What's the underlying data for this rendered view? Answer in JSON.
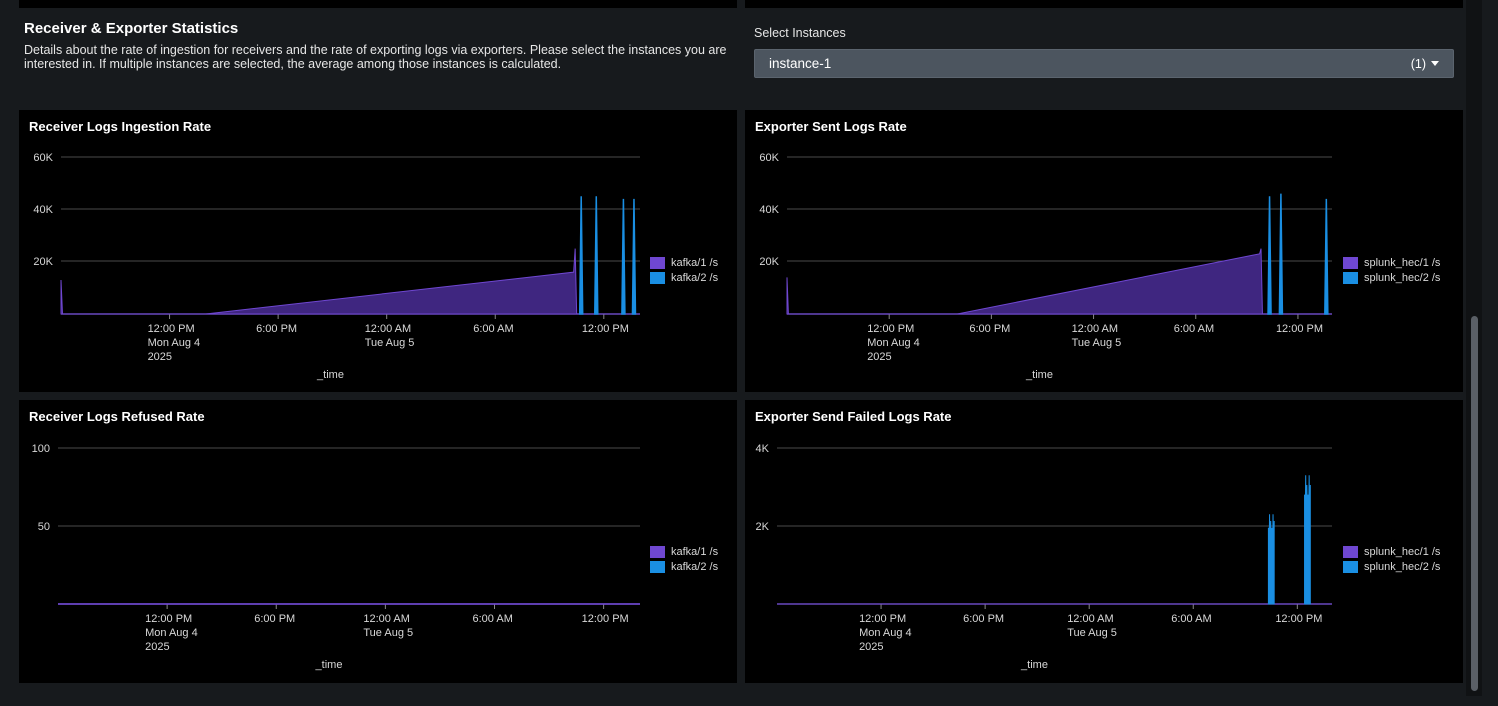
{
  "header": {
    "title": "Receiver & Exporter Statistics",
    "description": "Details about the rate of ingestion for receivers and the rate of exporting logs via exporters. Please select the instances you are interested in. If multiple instances are selected, the average among those instances is calculated."
  },
  "instance_select": {
    "label": "Select Instances",
    "value": "instance-1",
    "count": "(1)"
  },
  "colors": {
    "series1": "#6f47d1",
    "series1_fill": "#3f2680",
    "series2": "#1a8fe3"
  },
  "panels": [
    {
      "title": "Receiver Logs Ingestion Rate",
      "x_title": "_time",
      "y_ticks": [
        "60K",
        "40K",
        "20K"
      ],
      "legend": [
        "kafka/1 /s",
        "kafka/2 /s"
      ]
    },
    {
      "title": "Exporter Sent Logs Rate",
      "x_title": "_time",
      "y_ticks": [
        "60K",
        "40K",
        "20K"
      ],
      "legend": [
        "splunk_hec/1 /s",
        "splunk_hec/2 /s"
      ]
    },
    {
      "title": "Receiver Logs Refused Rate",
      "x_title": "_time",
      "y_ticks": [
        "100",
        "50"
      ],
      "legend": [
        "kafka/1 /s",
        "kafka/2 /s"
      ]
    },
    {
      "title": "Exporter Send Failed Logs Rate",
      "x_title": "_time",
      "y_ticks": [
        "4K",
        "2K"
      ],
      "legend": [
        "splunk_hec/1 /s",
        "splunk_hec/2 /s"
      ]
    }
  ],
  "x_ticks": [
    {
      "lines": [
        "12:00 PM",
        "Mon Aug 4",
        "2025"
      ]
    },
    {
      "lines": [
        "6:00 PM"
      ]
    },
    {
      "lines": [
        "12:00 AM",
        "Tue Aug 5"
      ]
    },
    {
      "lines": [
        "6:00 AM"
      ]
    },
    {
      "lines": [
        "12:00 PM"
      ]
    }
  ],
  "chart_data": [
    {
      "type": "area",
      "title": "Receiver Logs Ingestion Rate",
      "xlabel": "_time",
      "x_range": [
        "Mon Aug 4 2025 ~06:00 AM",
        "Tue Aug 5 2025 ~2:00 PM"
      ],
      "ylim": [
        0,
        60000
      ],
      "series": [
        {
          "name": "kafka/1 /s",
          "points": [
            [
              "Mon Aug 4 06:00",
              13000
            ],
            [
              "Mon Aug 4 06:05",
              0
            ],
            [
              "Mon Aug 4 14:00",
              0
            ],
            [
              "Tue Aug 5 10:20",
              16000
            ],
            [
              "Tue Aug 5 10:25",
              25000
            ],
            [
              "Tue Aug 5 10:30",
              0
            ],
            [
              "Tue Aug 5 14:00",
              0
            ]
          ]
        },
        {
          "name": "kafka/2 /s",
          "points": [
            [
              "Tue Aug 5 10:45",
              45000
            ],
            [
              "Tue Aug 5 11:35",
              45000
            ],
            [
              "Tue Aug 5 13:05",
              44000
            ],
            [
              "Tue Aug 5 13:40",
              44000
            ]
          ]
        }
      ]
    },
    {
      "type": "area",
      "title": "Exporter Sent Logs Rate",
      "xlabel": "_time",
      "x_range": [
        "Mon Aug 4 2025 ~06:00 AM",
        "Tue Aug 5 2025 ~2:00 PM"
      ],
      "ylim": [
        0,
        60000
      ],
      "series": [
        {
          "name": "splunk_hec/1 /s",
          "points": [
            [
              "Mon Aug 4 06:00",
              14000
            ],
            [
              "Mon Aug 4 06:05",
              0
            ],
            [
              "Mon Aug 4 16:00",
              0
            ],
            [
              "Tue Aug 5 09:45",
              23000
            ],
            [
              "Tue Aug 5 09:50",
              25000
            ],
            [
              "Tue Aug 5 09:55",
              0
            ],
            [
              "Tue Aug 5 14:00",
              0
            ]
          ]
        },
        {
          "name": "splunk_hec/2 /s",
          "points": [
            [
              "Tue Aug 5 10:20",
              45000
            ],
            [
              "Tue Aug 5 11:00",
              46000
            ],
            [
              "Tue Aug 5 13:40",
              44000
            ]
          ]
        }
      ]
    },
    {
      "type": "area",
      "title": "Receiver Logs Refused Rate",
      "xlabel": "_time",
      "x_range": [
        "Mon Aug 4 2025 ~06:00 AM",
        "Tue Aug 5 2025 ~2:00 PM"
      ],
      "ylim": [
        0,
        100
      ],
      "series": [
        {
          "name": "kafka/1 /s",
          "points": [
            [
              "Mon Aug 4 06:00",
              0
            ],
            [
              "Tue Aug 5 14:00",
              0
            ]
          ]
        },
        {
          "name": "kafka/2 /s",
          "points": [
            [
              "Mon Aug 4 06:00",
              0
            ],
            [
              "Tue Aug 5 14:00",
              0
            ]
          ]
        }
      ]
    },
    {
      "type": "area",
      "title": "Exporter Send Failed Logs Rate",
      "xlabel": "_time",
      "x_range": [
        "Mon Aug 4 2025 ~06:00 AM",
        "Tue Aug 5 2025 ~2:00 PM"
      ],
      "ylim": [
        0,
        4000
      ],
      "series": [
        {
          "name": "splunk_hec/1 /s",
          "points": [
            [
              "Mon Aug 4 06:00",
              0
            ],
            [
              "Tue Aug 5 14:00",
              0
            ]
          ]
        },
        {
          "name": "splunk_hec/2 /s",
          "points": [
            [
              "Tue Aug 5 10:20",
              2300
            ],
            [
              "Tue Aug 5 10:40",
              1300
            ],
            [
              "Tue Aug 5 12:25",
              3300
            ],
            [
              "Tue Aug 5 12:45",
              2300
            ]
          ]
        }
      ]
    }
  ]
}
